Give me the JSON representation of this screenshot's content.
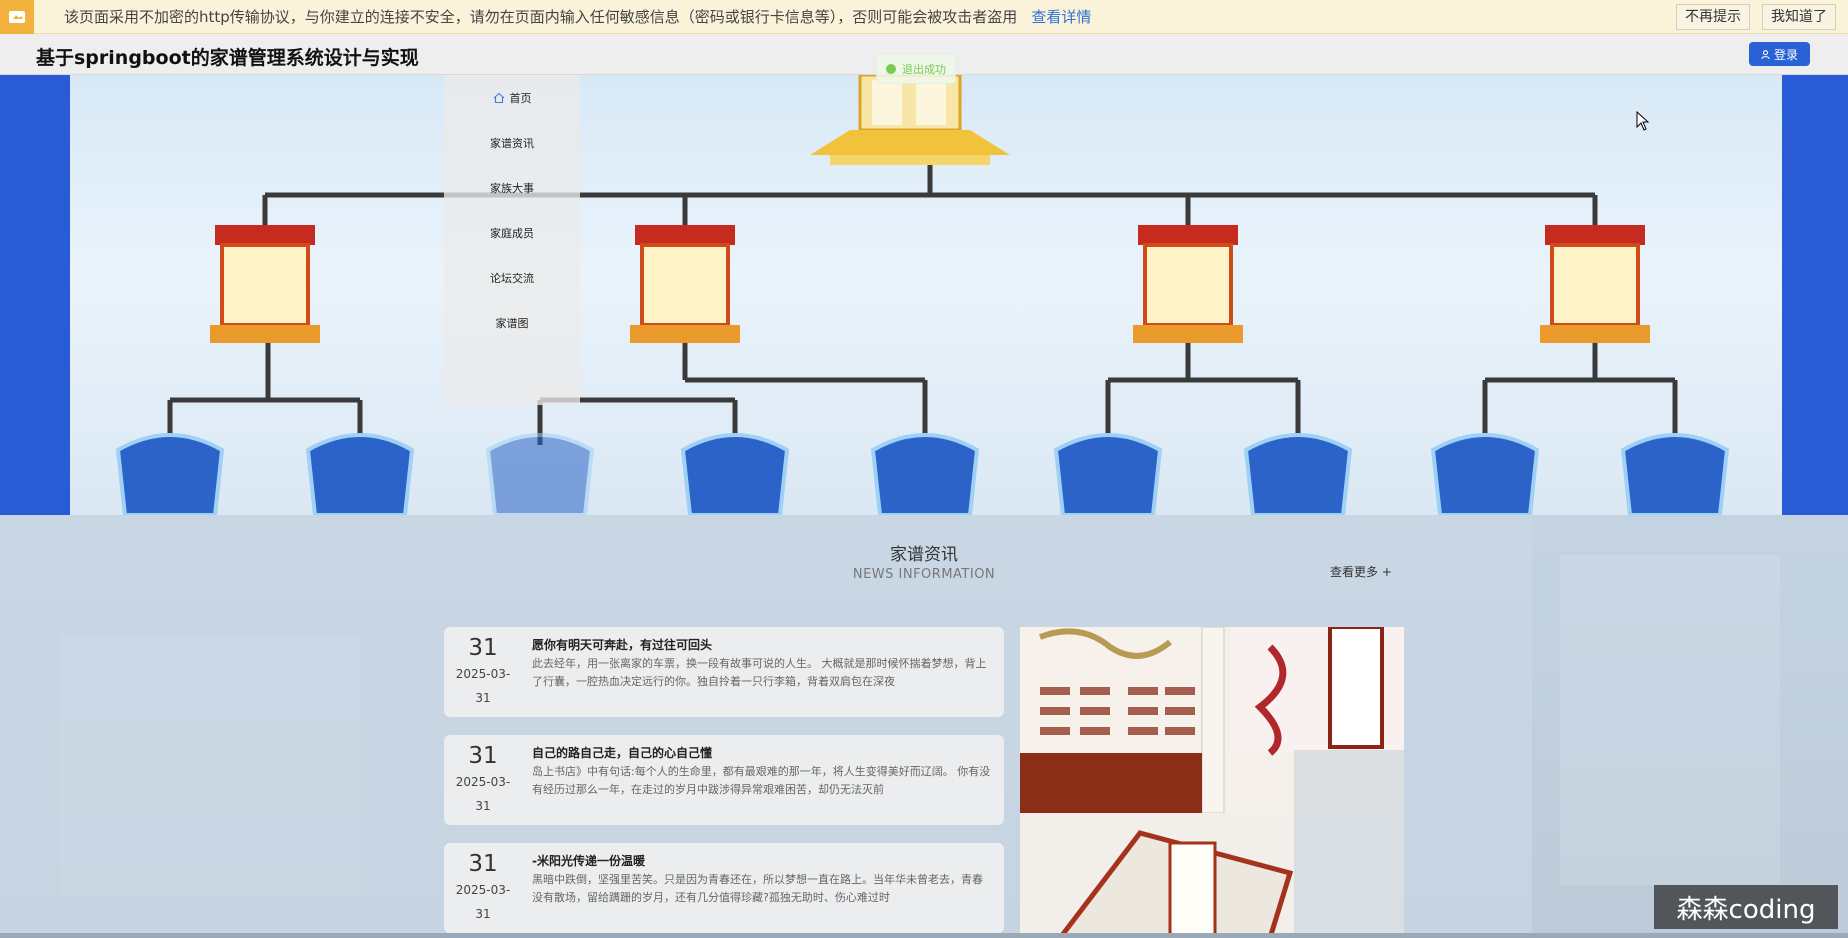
{
  "warning_bar": {
    "message": "该页面采用不加密的http传输协议，与你建立的连接不安全，请勿在页面内输入任何敏感信息（密码或银行卡信息等），否则可能会被攻击者盗用",
    "details_link": "查看详情",
    "dont_remind": "不再提示",
    "got_it": "我知道了",
    "icon": "warning-icon"
  },
  "header": {
    "site_title": "基于springboot的家谱管理系统设计与实现",
    "login_label": "登录",
    "login_icon": "user-icon"
  },
  "toast": {
    "message": "退出成功",
    "icon": "success-check-icon"
  },
  "nav": {
    "items": [
      {
        "label": "首页",
        "icon": "home-icon"
      },
      {
        "label": "家谱资讯"
      },
      {
        "label": "家族大事"
      },
      {
        "label": "家庭成员"
      },
      {
        "label": "论坛交流"
      },
      {
        "label": "家谱图"
      }
    ]
  },
  "news": {
    "title": "家谱资讯",
    "subtitle": "NEWS INFORMATION",
    "more_label": "查看更多 +",
    "items": [
      {
        "day": "31",
        "date_line1": "2025-03-",
        "date_line2": "31",
        "title": "愿你有明天可奔赴，有过往可回头",
        "excerpt": "此去经年，用一张离家的车票，换一段有故事可说的人生。 大概就是那时候怀揣着梦想，背上了行囊，一腔热血决定远行的你。独自拎着一只行李箱，背着双肩包在深夜"
      },
      {
        "day": "31",
        "date_line1": "2025-03-",
        "date_line2": "31",
        "title": "自己的路自己走，自己的心自己懂",
        "excerpt": "岛上书店》中有句话:每个人的生命里，都有最艰难的那一年，将人生变得美好而辽阔。 你有没有经历过那么一年，在走过的岁月中跋涉得异常艰难困苦，却仍无法灭前"
      },
      {
        "day": "31",
        "date_line1": "2025-03-",
        "date_line2": "31",
        "title": "-米阳光传递一份温暖",
        "excerpt": "黑暗中跌倒，坚强里苦笑。只是因为青春还在，所以梦想一直在路上。当年华未曾老去，青春没有散场，留给蹒跚的岁月，还有几分值得珍藏?孤独无助时、伤心难过时"
      }
    ]
  },
  "watermark": "森森coding",
  "colors": {
    "accent_blue": "#2a62d6",
    "warning_bg": "#fbf3d9",
    "toast_green": "#67c23a",
    "link_blue": "#2f6fd8"
  }
}
